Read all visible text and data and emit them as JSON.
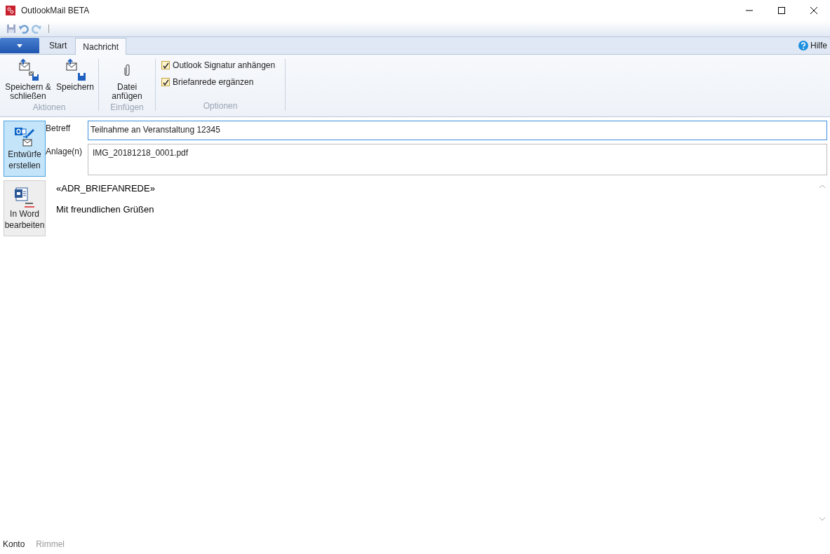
{
  "window": {
    "title": "OutlookMail BETA"
  },
  "tabs": [
    {
      "label": "Start",
      "selected": false
    },
    {
      "label": "Nachricht",
      "selected": true
    }
  ],
  "help": "Hilfe",
  "ribbon_groups": [
    {
      "kind": "buttons",
      "label": "Aktionen",
      "buttons": [
        {
          "label": "Speichern & schließen"
        },
        {
          "label": "Speichern"
        }
      ]
    },
    {
      "kind": "buttons",
      "label": "Einfügen",
      "buttons": [
        {
          "label": "Datei anfügen"
        }
      ]
    },
    {
      "kind": "checkboxes",
      "label": "Optionen",
      "checkboxes": [
        {
          "label": "Outlook Signatur anhängen",
          "checked": true
        },
        {
          "label": "Briefanrede ergänzen",
          "checked": true
        }
      ]
    }
  ],
  "side_buttons": [
    {
      "label": "Entwürfe erstellen",
      "selected": true
    },
    {
      "label": "In Word bearbeiten",
      "selected": false
    }
  ],
  "fields": [
    {
      "label": "Betreff",
      "value": "Teilnahme an Veranstaltung 12345",
      "focused": true
    },
    {
      "label": "Anlage(n)",
      "value": "IMG_20181218_0001.pdf",
      "focused": false
    }
  ],
  "body": [
    "«ADR_BRIEFANREDE»",
    "Mit freundlichen Grüßen"
  ],
  "status_bar": [
    {
      "label": "Konto",
      "disabled": false
    },
    {
      "label": "Rimmel",
      "disabled": true
    }
  ]
}
